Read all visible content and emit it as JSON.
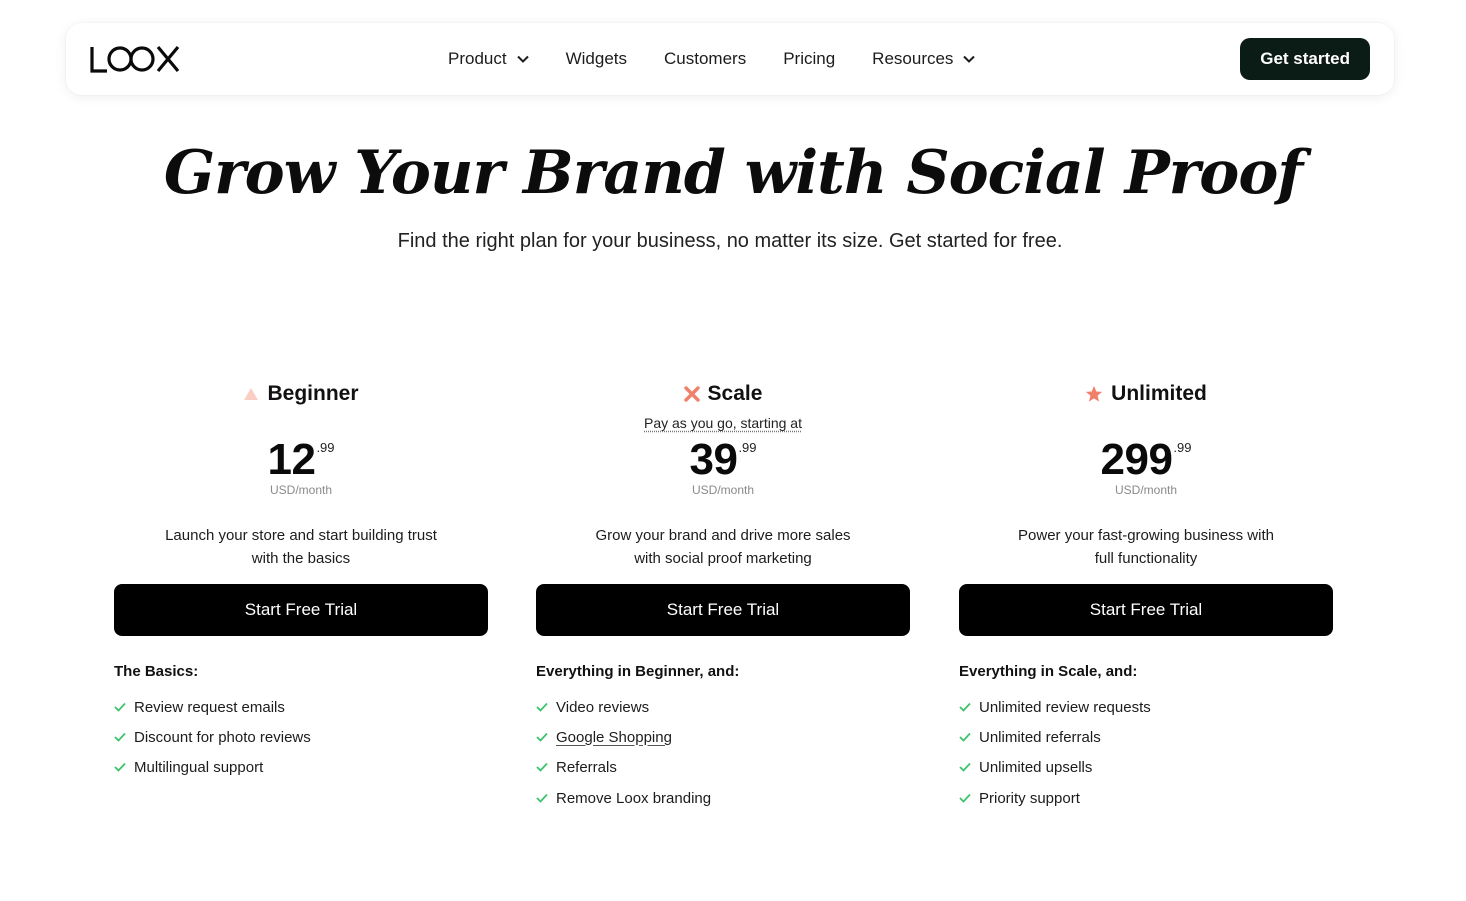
{
  "header": {
    "logo_text": "LOOX",
    "nav": [
      {
        "label": "Product",
        "has_dropdown": true
      },
      {
        "label": "Widgets",
        "has_dropdown": false
      },
      {
        "label": "Customers",
        "has_dropdown": false
      },
      {
        "label": "Pricing",
        "has_dropdown": false
      },
      {
        "label": "Resources",
        "has_dropdown": true
      }
    ],
    "cta_label": "Get started"
  },
  "hero": {
    "title": "Grow Your Brand with Social Proof",
    "subtitle": "Find the right plan for your business, no matter its size. Get started for free."
  },
  "plans": [
    {
      "name": "Beginner",
      "icon": "triangle-icon",
      "note": "",
      "price": "12",
      "cents": ".99",
      "unit": "USD/month",
      "desc_line1": "Launch your store and start building trust",
      "desc_line2": "with the basics",
      "button": "Start Free Trial",
      "features_title": "The Basics:",
      "features": [
        "Review request emails",
        "Discount for photo reviews",
        "Multilingual support"
      ]
    },
    {
      "name": "Scale",
      "icon": "x-shape-icon",
      "note": "Pay as you go, starting at",
      "price": "39",
      "cents": ".99",
      "unit": "USD/month",
      "desc_line1": "Grow your brand and drive more sales",
      "desc_line2": "with social proof marketing",
      "button": "Start Free Trial",
      "features_title": "Everything in Beginner, and:",
      "features": [
        "Video reviews",
        "Google Shopping",
        "Referrals",
        "Remove Loox branding"
      ]
    },
    {
      "name": "Unlimited",
      "icon": "star-icon",
      "note": "",
      "price": "299",
      "cents": ".99",
      "unit": "USD/month",
      "desc_line1": "Power your fast-growing business with",
      "desc_line2": "full functionality",
      "button": "Start Free Trial",
      "features_title": "Everything in Scale, and:",
      "features": [
        "Unlimited review requests",
        "Unlimited referrals",
        "Unlimited upsells",
        "Priority support"
      ]
    }
  ],
  "colors": {
    "cta_bg": "#0b1c16",
    "button_bg": "#000000",
    "accent_coral": "#f0806a",
    "accent_light": "#f9cfc3",
    "check_green": "#3cc46b"
  }
}
